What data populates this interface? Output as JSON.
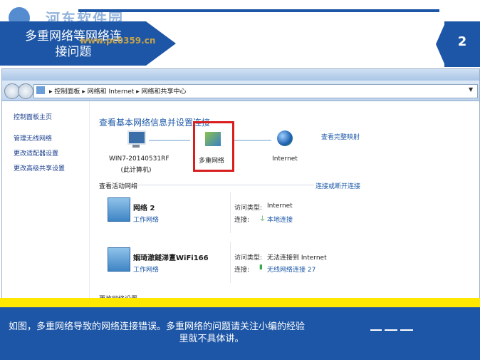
{
  "header": {
    "title_line1": "多重网络等网络连",
    "title_line2": "接问题",
    "watermark": "河东软件园",
    "watermark_url": "www.pc0359.cn",
    "slide_number": "2"
  },
  "window": {
    "breadcrumb": [
      "控制面板",
      "网络和 Internet",
      "网络和共享中心"
    ],
    "sidebar": [
      "控制面板主页",
      "管理无线网络",
      "更改适配器设置",
      "更改高级共享设置"
    ],
    "main_title": "查看基本网络信息并设置连接",
    "full_map_link": "查看完整映射",
    "nodes": {
      "computer_name": "WIN7-20140531RF",
      "computer_sub": "(此计算机)",
      "multi_network": "多重网络",
      "internet": "Internet"
    },
    "active_networks_label": "查看活动网络",
    "connect_link": "连接或断开连接",
    "networks": [
      {
        "name": "网络 2",
        "type": "工作网络",
        "access_key": "访问类型:",
        "access_val": "Internet",
        "conn_key": "连接:",
        "conn_val": "本地连接"
      },
      {
        "name": "姻琦澈鐩涕亶WiFi166",
        "type": "工作网络",
        "access_key": "访问类型:",
        "access_val": "无法连接到 Internet",
        "conn_key": "连接:",
        "conn_val": "无线网络连接 27"
      }
    ],
    "cut_text": "更改网络设置"
  },
  "caption": {
    "line1": "如图，多重网络导致的网络连接错误。多重网络的问题请关注小编的经验",
    "line2": "里就不具体讲。"
  },
  "colors": {
    "brand_blue": "#1d56a6",
    "highlight_red": "#d81e1e",
    "accent_yellow": "#ffe800"
  }
}
